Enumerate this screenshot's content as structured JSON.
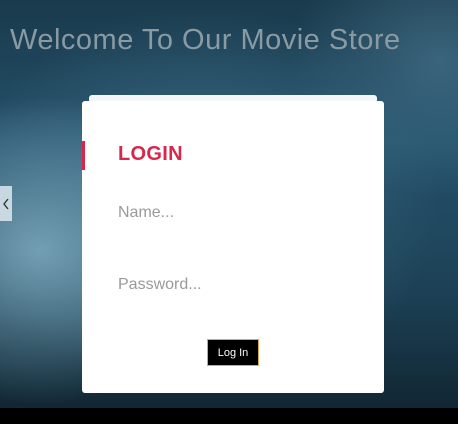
{
  "header": {
    "welcome_text": "Welcome To Our Movie Store"
  },
  "login": {
    "title": "LOGIN",
    "name_placeholder": "Name...",
    "password_placeholder": "Password...",
    "button_label": "Log In"
  },
  "side_tab": {
    "icon": "chevron-left-icon"
  },
  "colors": {
    "accent": "#d8274b",
    "button_border": "#e0a64a",
    "card": "#ffffff",
    "title_text": "#8a9aa2"
  }
}
